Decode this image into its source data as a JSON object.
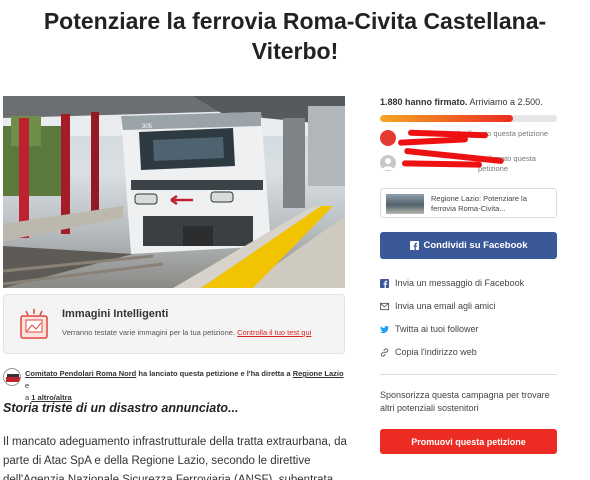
{
  "title_line1": "Potenziare la ferrovia Roma-Civita Castellana-",
  "title_line2": "Viterbo!",
  "hero": {
    "train_number": "305"
  },
  "smart_images": {
    "title": "Immagini Intelligenti",
    "desc": "Verranno testate varie immagini per la tua petizione.",
    "link": "Controlla il tuo test qui"
  },
  "starter": {
    "org": "Comitato Pendolari Roma Nord",
    "mid": "ha lanciato questa petizione e l'ha diretta a",
    "target": "Regione Lazio",
    "join": "e",
    "prefix": "a",
    "other": "1 altro/altra"
  },
  "story": {
    "title": "Storia triste di un disastro annunciato...",
    "p1": "Il mancato adeguamento infrastrutturale della tratta extraurbana, da parte di Atac SpA e della Regione Lazio, secondo le direttive dell'Agenzia Nazionale Sicurezza Ferroviaria (ANSF), subentrata"
  },
  "signatures": {
    "count": "1.880 hanno firmato.",
    "goal": "Arriviamo a 2.500.",
    "progress_fraction": 0.75
  },
  "signers": [
    {
      "text": "ha firmato questa petizione"
    },
    {
      "text": "ha firmato questa petizione"
    }
  ],
  "decision_card": {
    "text": "Regione Lazio: Potenziare la ferrovia Roma-Civita..."
  },
  "share": {
    "facebook_button": "Condividi su Facebook",
    "messenger": "Invia un messaggio di Facebook",
    "email": "Invia una email agli amici",
    "twitter": "Twitta ai tuoi follower",
    "copy_link": "Copia l'indirizzo web"
  },
  "promote": {
    "text": "Sponsorizza questa campagna per trovare altri potenziali sostenitori",
    "button": "Promuovi questa petizione"
  },
  "colors": {
    "facebook": "#3b5998",
    "accent": "#ec2c22",
    "twitter": "#1da1f2"
  }
}
